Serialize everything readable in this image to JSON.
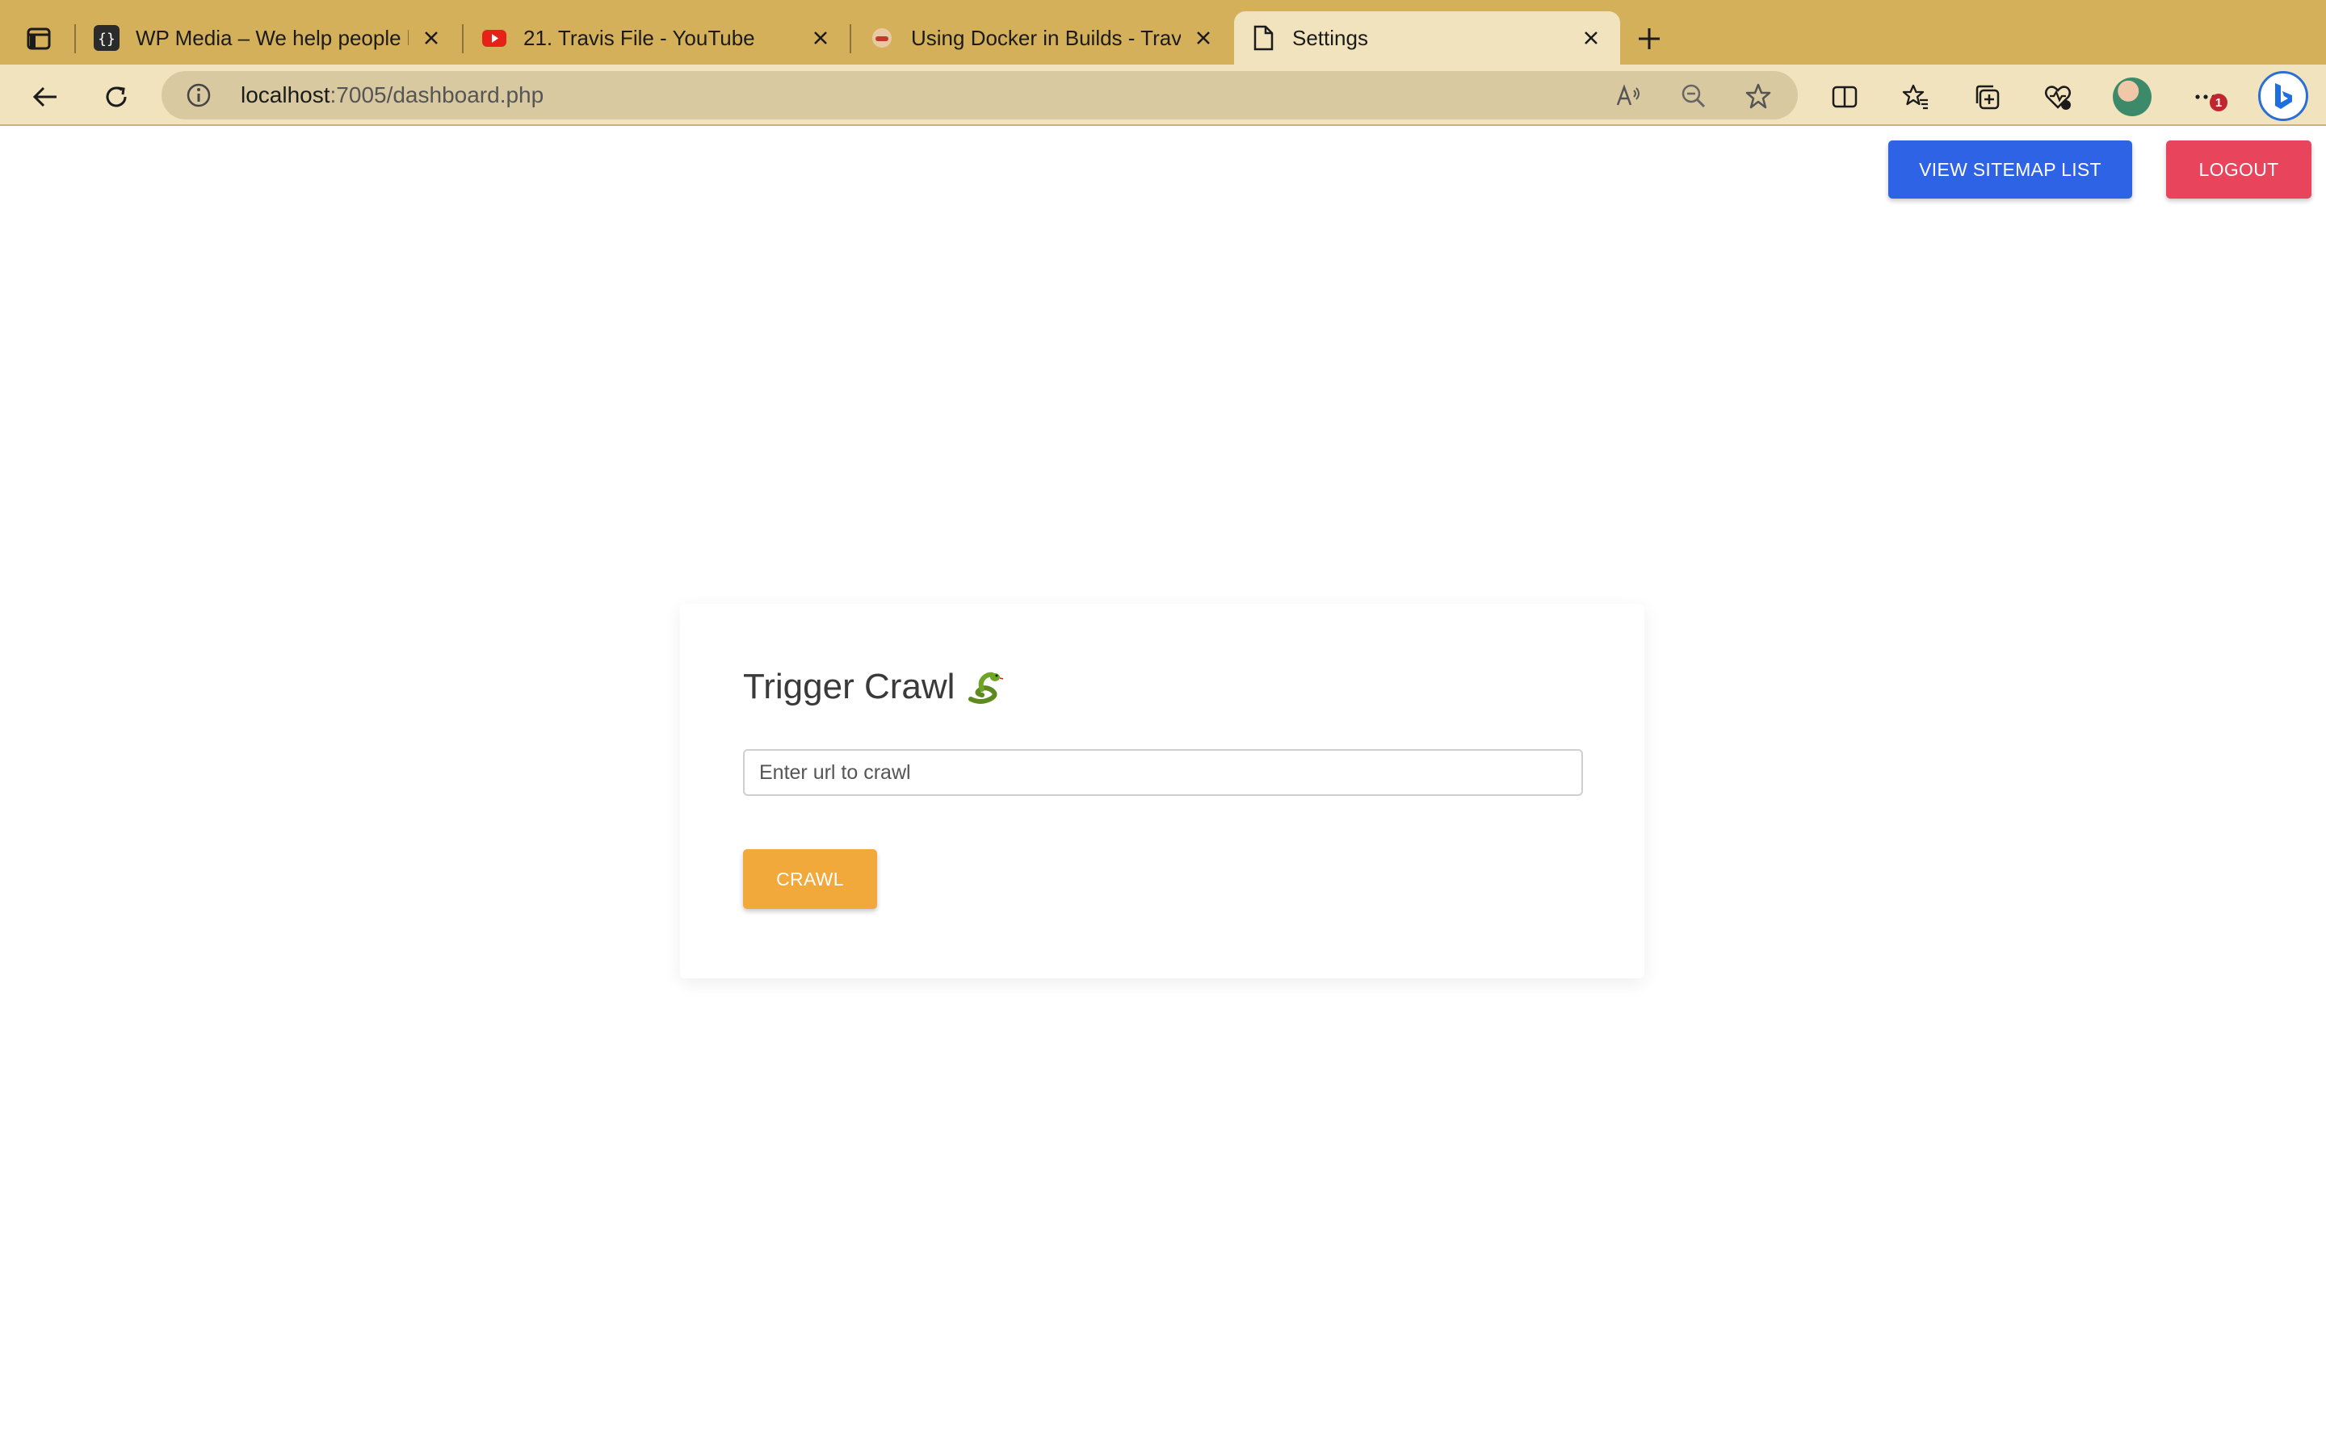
{
  "browser": {
    "tabs": [
      {
        "title": "WP Media – We help people ha",
        "favicon": "wp-media-icon"
      },
      {
        "title": "21. Travis File - YouTube",
        "favicon": "youtube-icon"
      },
      {
        "title": "Using Docker in Builds - Travis",
        "favicon": "travis-icon"
      },
      {
        "title": "Settings",
        "favicon": "page-icon",
        "active": true
      }
    ],
    "address": {
      "host": "localhost",
      "path": ":7005/dashboard.php"
    },
    "notification_count": "1"
  },
  "header": {
    "sitemap_button": "VIEW SITEMAP LIST",
    "logout_button": "LOGOUT"
  },
  "crawl_card": {
    "title": "Trigger Crawl",
    "url_placeholder": "Enter url to crawl",
    "url_value": "",
    "crawl_button": "CRAWL"
  },
  "colors": {
    "sitemap_button": "#2f63e6",
    "logout_button": "#e8445c",
    "crawl_button": "#f2a93b",
    "tab_strip": "#d4b05a"
  }
}
